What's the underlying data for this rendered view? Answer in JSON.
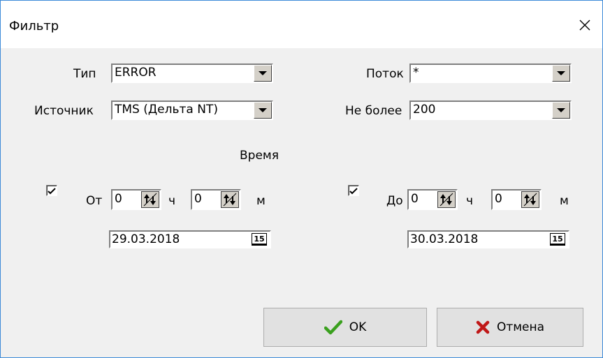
{
  "window": {
    "title": "Фильтр"
  },
  "fields": {
    "type_label": "Тип",
    "type_value": "ERROR",
    "source_label": "Источник",
    "source_value": "TMS (Дельта NT)",
    "thread_label": "Поток",
    "thread_value": "*",
    "limit_label": "Не более",
    "limit_value": "200"
  },
  "time": {
    "heading": "Время",
    "from": {
      "checked": true,
      "label": "От",
      "hours": "0",
      "hours_unit": "ч",
      "minutes": "0",
      "minutes_unit": "м",
      "date": "29.03.2018",
      "calendar_text": "15"
    },
    "to": {
      "checked": true,
      "label": "До",
      "hours": "0",
      "hours_unit": "ч",
      "minutes": "0",
      "minutes_unit": "м",
      "date": "30.03.2018",
      "calendar_text": "15"
    }
  },
  "buttons": {
    "ok": "OK",
    "cancel": "Отмена"
  },
  "icons": {
    "close": "close-icon",
    "dropdown": "chevron-down-icon",
    "spin": "spin-arrows-icon",
    "checkbox": "checkmark-icon",
    "calendar": "calendar-icon",
    "ok": "green-checkmark-icon",
    "cancel": "red-x-icon"
  },
  "colors": {
    "accent_border": "#3c8ad8",
    "ok_green": "#3aa01e",
    "cancel_red": "#c01818"
  }
}
